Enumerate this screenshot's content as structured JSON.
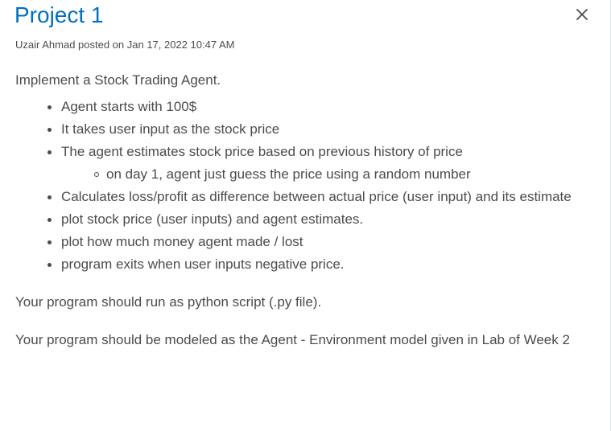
{
  "header": {
    "title": "Project 1",
    "close_icon": "close-icon"
  },
  "post": {
    "meta": "Uzair Ahmad posted on Jan 17, 2022 10:47 AM"
  },
  "body": {
    "intro": "Implement a Stock Trading Agent.",
    "bullets": [
      "Agent starts with 100$",
      "It takes user input as the stock price",
      "The agent estimates stock price based on previous history of price",
      "Calculates loss/profit as difference between actual price (user input) and its estimate",
      "plot stock price (user inputs) and agent estimates.",
      "plot how much money agent made / lost",
      "program exits when user inputs negative price."
    ],
    "sub_bullets": [
      "on day 1, agent just guess the price using a random number"
    ],
    "paragraph_2": "Your program should run as python script (.py file).",
    "paragraph_3": "Your program should be modeled as the Agent - Environment model given in Lab of Week 2"
  },
  "colors": {
    "title": "#006fbf",
    "text": "#494c4e",
    "background": "#ffffff"
  }
}
